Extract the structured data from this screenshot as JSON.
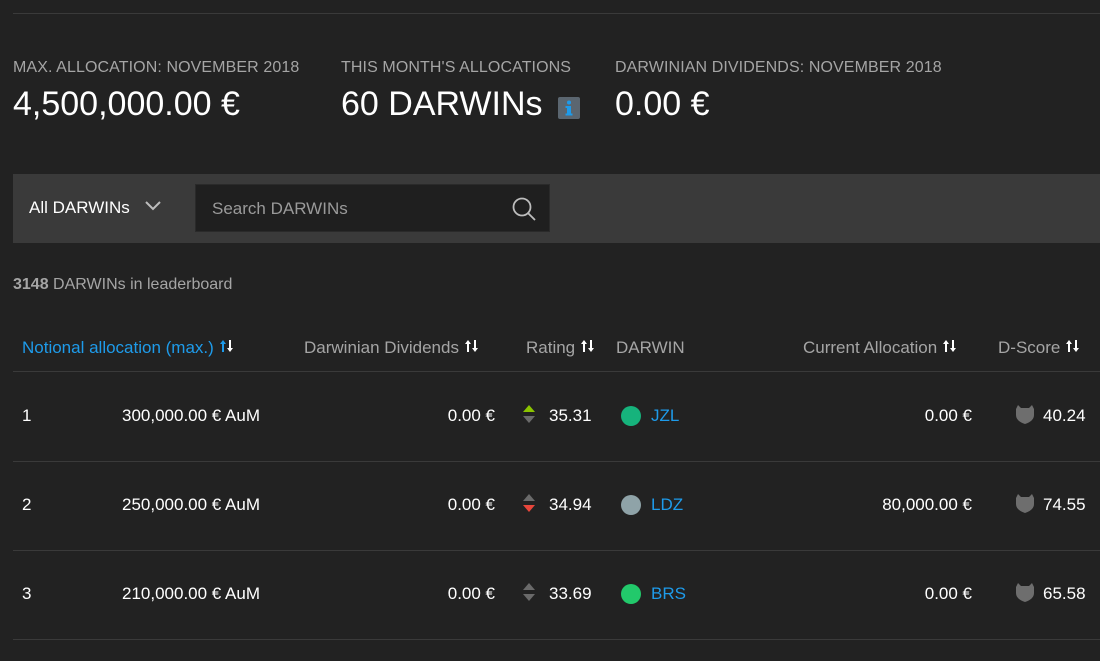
{
  "stats": [
    {
      "label": "MAX. ALLOCATION: NOVEMBER 2018",
      "value": "4,500,000.00 €"
    },
    {
      "label": "THIS MONTH'S ALLOCATIONS",
      "value": "60 DARWINs"
    },
    {
      "label": "DARWINIAN DIVIDENDS: NOVEMBER 2018",
      "value": "0.00 €"
    }
  ],
  "filter": {
    "dropdown_label": "All DARWINs",
    "search_placeholder": "Search DARWINs"
  },
  "leaderboard": {
    "count_number": "3148",
    "count_suffix": "DARWINs in leaderboard"
  },
  "columns": {
    "notional": "Notional allocation (max.)",
    "dividends": "Darwinian Dividends",
    "rating": "Rating",
    "darwin": "DARWIN",
    "current": "Current Allocation",
    "dscore": "D-Score"
  },
  "rows": [
    {
      "rank": "1",
      "notional": "300,000.00 € AuM",
      "dividends": "0.00 €",
      "rating": "35.31",
      "rating_trend": "up",
      "darwin": "JZL",
      "dot_color": "#16b37c",
      "current": "0.00 €",
      "dscore": "40.24"
    },
    {
      "rank": "2",
      "notional": "250,000.00 € AuM",
      "dividends": "0.00 €",
      "rating": "34.94",
      "rating_trend": "down",
      "darwin": "LDZ",
      "dot_color": "#8fa3a8",
      "current": "80,000.00 €",
      "dscore": "74.55"
    },
    {
      "rank": "3",
      "notional": "210,000.00 € AuM",
      "dividends": "0.00 €",
      "rating": "33.69",
      "rating_trend": "flat",
      "darwin": "BRS",
      "dot_color": "#22c96b",
      "current": "0.00 €",
      "dscore": "65.58"
    }
  ],
  "colors": {
    "accent": "#1e9bea",
    "trend_up": "#8bc400",
    "trend_down": "#e8463b",
    "trend_neutral": "#6a6a6a"
  },
  "icons": {
    "info": "info-icon",
    "dropdown": "chevron-down-icon",
    "search": "search-icon",
    "sort": "sort-arrows-icon",
    "dscore": "shield-icon"
  }
}
